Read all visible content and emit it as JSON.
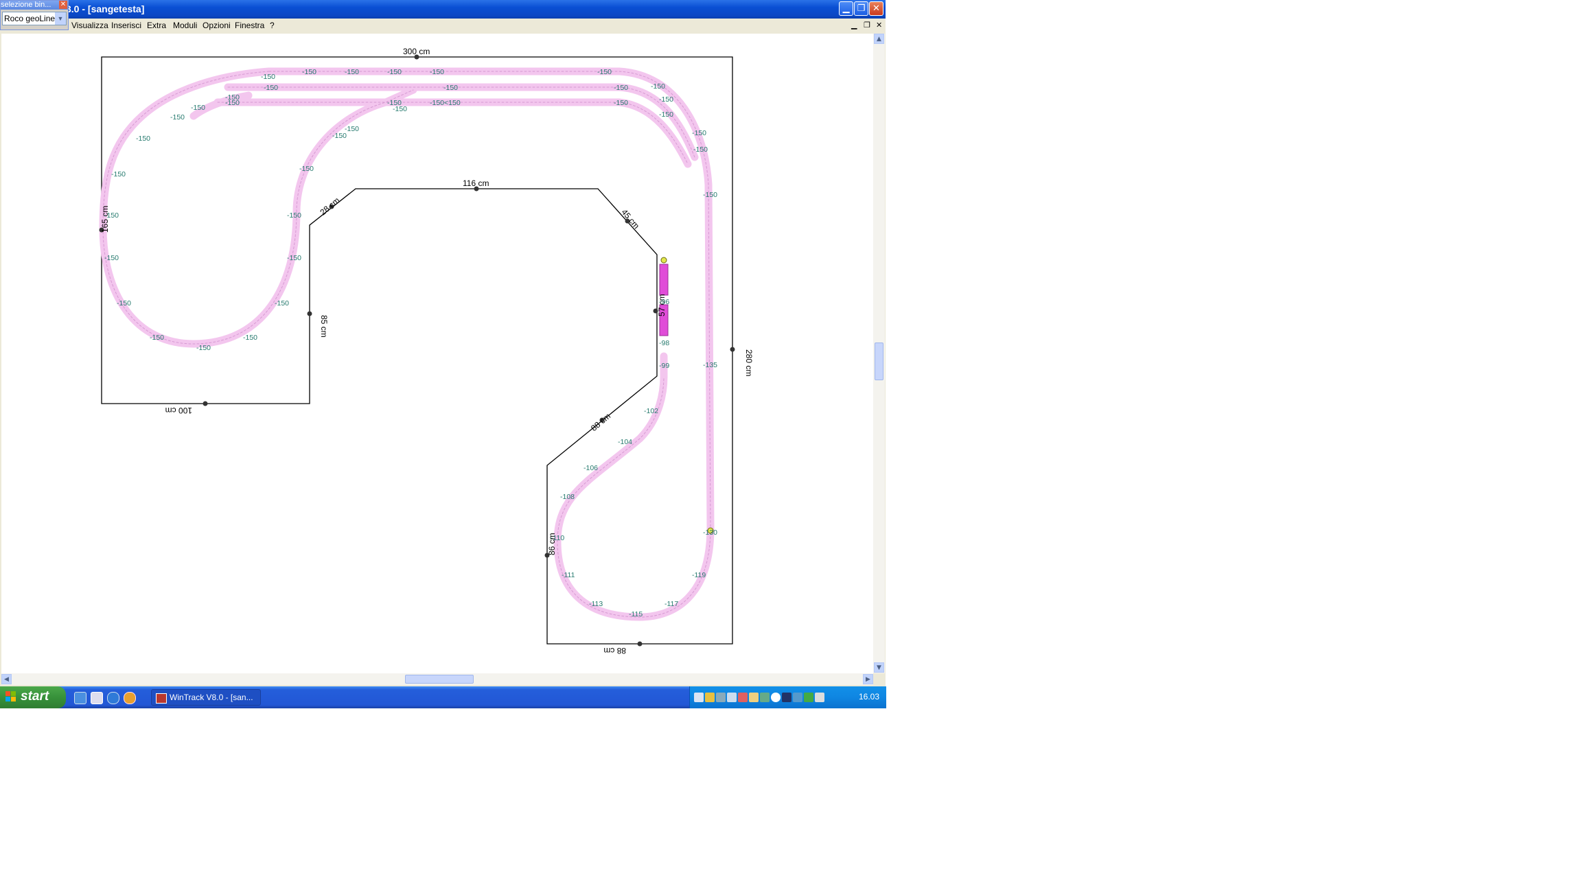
{
  "window": {
    "title": "3.0 - [sangetesta]",
    "menu": [
      "Visualizza",
      "Inserisci",
      "Extra",
      "Moduli",
      "Opzioni",
      "Finestra",
      "?"
    ]
  },
  "tool_window": {
    "title": "selezione bin...",
    "select_value": "Roco geoLine H"
  },
  "layout": {
    "dimensions": [
      "300 cm",
      "116 cm",
      "28 cm",
      "45 cm",
      "57 cm",
      "165 cm",
      "85 cm",
      "100 cm",
      "280 cm",
      "88 cm",
      "86 cm",
      "88 cm"
    ],
    "radius_labels": {
      "top": [
        "-150",
        "-150",
        "-150",
        "-150",
        "-150",
        "-150",
        "-150",
        "-150",
        "-150",
        "-150",
        "-150",
        "-150",
        "-150",
        "-150",
        "-150",
        "-150",
        "-150",
        "-150"
      ],
      "inner_loop": [
        "-150",
        "-150",
        "-150",
        "-150",
        "-150",
        "-150",
        "-150",
        "-150",
        "-150",
        "-150",
        "-150",
        "-150"
      ],
      "right_side": [
        "-150",
        "-150",
        "-150",
        "-150",
        "-150",
        "-135",
        "-130"
      ],
      "lower_curve": [
        "-99",
        "-102",
        "-104",
        "-106",
        "-108",
        "-110",
        "-111",
        "-113",
        "-115",
        "-117",
        "-119"
      ],
      "short_segments": [
        "-96",
        "-98",
        "-150"
      ],
      "junction": "-150<150"
    },
    "colors": {
      "track": "#f3c6ee",
      "track_edge": "#d69ad2",
      "selected_track": "#e04dd8",
      "radius_text": "#267a6e",
      "board_outline": "#000000"
    }
  },
  "taskbar": {
    "start_label": "start",
    "tasks": [
      "WinTrack V8.0 - [san..."
    ],
    "clock": "16.03"
  }
}
